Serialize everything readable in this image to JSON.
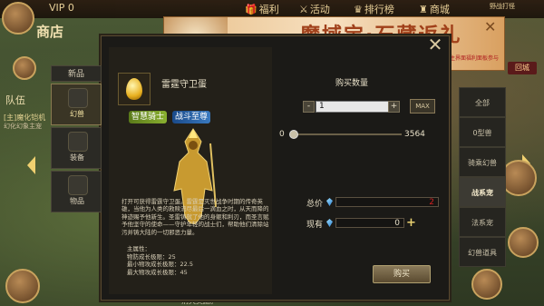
{
  "hud": {
    "vip": "VIP 0",
    "welfare": "福利",
    "activity": "活动",
    "ranking": "排行榜",
    "mall": "商城",
    "shop_label": "商店",
    "team_label": "队伍",
    "guild_label": "[主]魔化铠机",
    "guild_sub": "幻化幻象主宠",
    "back_label": "回城",
    "top_right": "野战打怪",
    "bottom_hint": "消灭奖励。"
  },
  "banner": {
    "title": "魔域宝·石藏返礼",
    "note": "点击开启主界面福利面板参与"
  },
  "modal": {
    "close": "✕",
    "left_tabs": [
      {
        "label": "新品"
      },
      {
        "label": "幻兽"
      },
      {
        "label": "装备"
      },
      {
        "label": "物品"
      }
    ],
    "item": {
      "name": "雷霆守卫蛋",
      "tag1": "智慧骑士",
      "tag2": "战斗至尊",
      "description": "打开可获得雷霆守卫蛋。雷霆是灭世战争时期的传奇英雄，当他为人类的救赎流尽最后一滴血之时，从天而降的神迹赐予他新生。圣雷铸就了他的身躯和利刃，而圣言赋予他坚守的使命——守护年轻的战士们，帮助他们清除站污并铸大陆的一切邪恶力量。",
      "stats_title": "主属性：",
      "stats": [
        "物防成长极限：25",
        "最小物攻成长极限：22.5",
        "最大物攻成长极限：45"
      ]
    },
    "quantity": {
      "title": "购买数量",
      "minus": "-",
      "plus": "+",
      "value": "1",
      "max_label": "MAX",
      "slider_min": "0",
      "slider_max": "3564",
      "slider_level": 0.0003
    },
    "total_label": "总价",
    "total_value": "2",
    "owned_label": "现有",
    "owned_value": "0",
    "buy_label": "购买",
    "right_tabs": [
      {
        "label": "全部"
      },
      {
        "label": "0型兽"
      },
      {
        "label": "骑乘幻兽"
      },
      {
        "label": "战系宠"
      },
      {
        "label": "法系宠"
      },
      {
        "label": "幻兽道具"
      }
    ]
  }
}
